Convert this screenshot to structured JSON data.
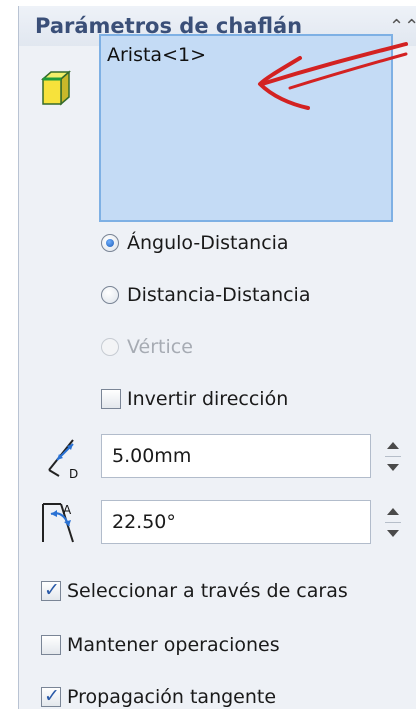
{
  "panel": {
    "title": "Parámetros de chaflán",
    "collapse_icon": "double-chevron-up-icon"
  },
  "edges": {
    "items": [
      "Arista<1>"
    ],
    "icon": "edge-selection-cube-icon",
    "list_bg": "#c4dbf5"
  },
  "options": {
    "angle_distance": {
      "label": "Ángulo-Distancia",
      "selected": true
    },
    "distance_distance": {
      "label": "Distancia-Distancia",
      "selected": false
    },
    "vertex": {
      "label": "Vértice",
      "selected": false,
      "disabled": true
    },
    "reverse_direction": {
      "label": "Invertir dirección",
      "checked": false
    }
  },
  "distance": {
    "value": "5.00mm",
    "icon": "distance-dimension-icon"
  },
  "angle": {
    "value": "22.50°",
    "icon": "angle-dimension-icon"
  },
  "checks": {
    "select_through_faces": {
      "label": "Seleccionar a través de caras",
      "checked": true
    },
    "keep_features": {
      "label": "Mantener operaciones",
      "checked": false
    },
    "tangent_propagation": {
      "label": "Propagación tangente",
      "checked": true
    }
  },
  "annotation": {
    "arrow_color": "#d32222"
  }
}
